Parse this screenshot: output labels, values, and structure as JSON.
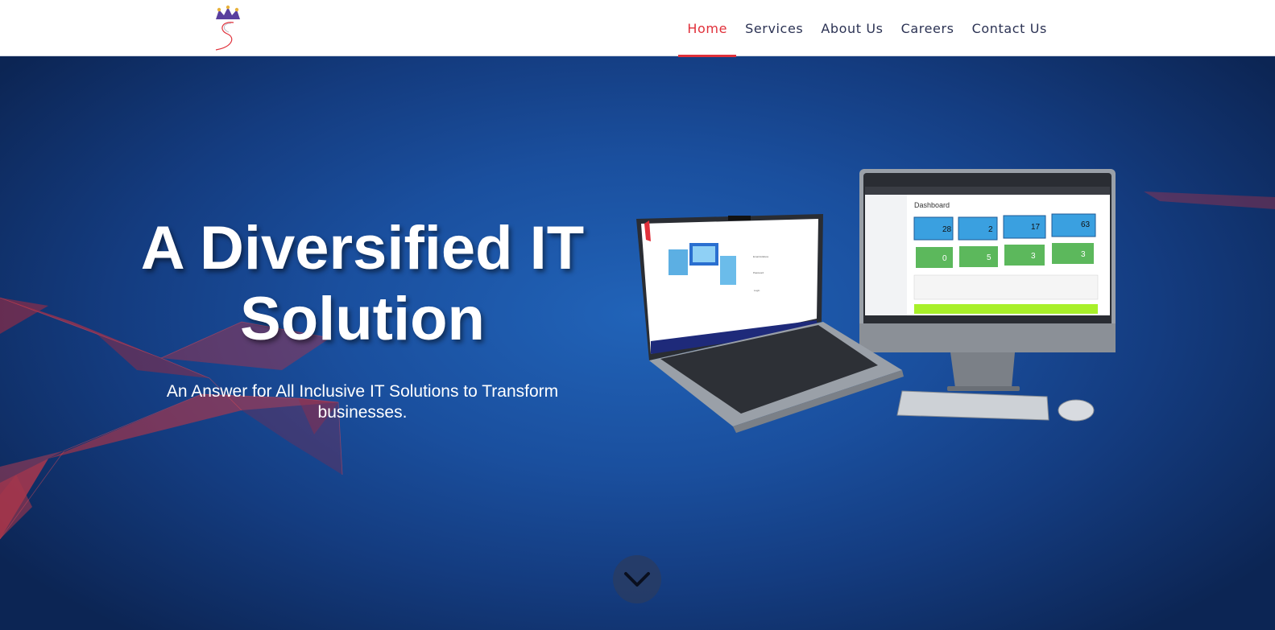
{
  "nav": {
    "items": [
      {
        "label": "Home",
        "active": true
      },
      {
        "label": "Services",
        "active": false
      },
      {
        "label": "About Us",
        "active": false
      },
      {
        "label": "Careers",
        "active": false
      },
      {
        "label": "Contact Us",
        "active": false
      }
    ]
  },
  "hero": {
    "title_line1": "A Diversified IT",
    "title_line2": "Solution",
    "subtitle": "An Answer for All Inclusive IT Solutions to Transform businesses."
  },
  "mockup": {
    "laptop": {
      "email_label": "Email Address",
      "password_label": "Password",
      "login_button": "Login"
    },
    "dashboard": {
      "title": "Dashboard",
      "blue_counts": [
        "28",
        "2",
        "17",
        "63"
      ],
      "green_counts": [
        "0",
        "5",
        "3",
        "3"
      ]
    }
  },
  "icons": {
    "logo": "crown-logo",
    "scroll": "chevron-down-icon"
  },
  "colors": {
    "accent": "#e0303a",
    "nav_text": "#2c3354",
    "hero_blue": "#1a4f9e",
    "stat_blue": "#3aa0e0",
    "stat_green": "#5cb85c"
  }
}
